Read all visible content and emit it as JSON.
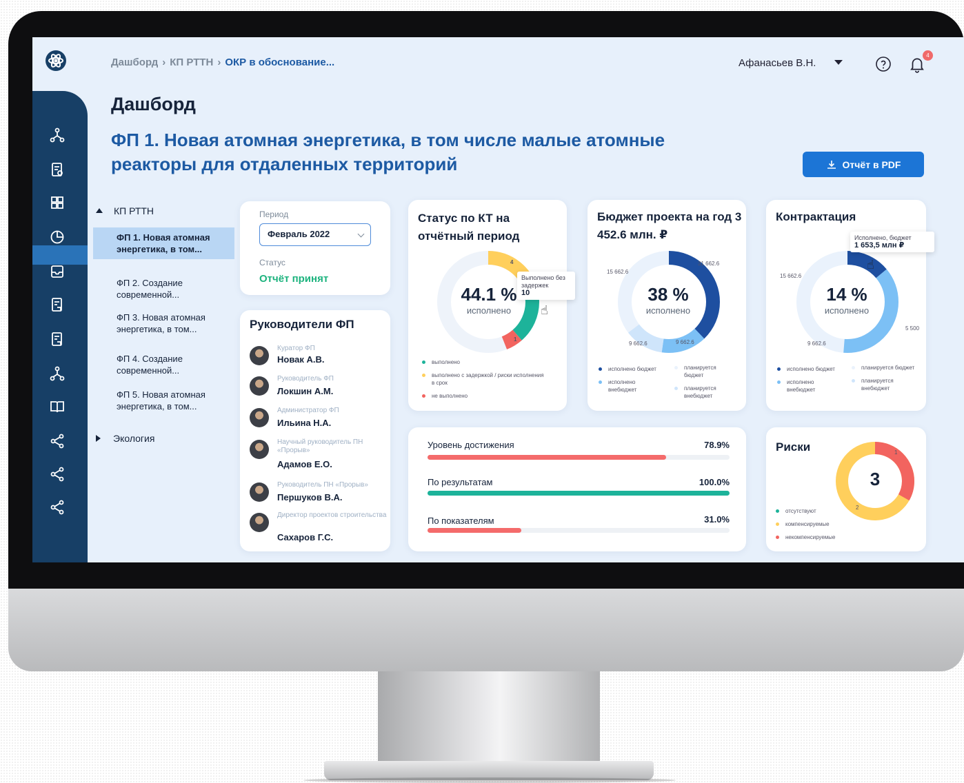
{
  "header": {
    "breadcrumbs": [
      "Дашборд",
      "КП РТТН",
      "ОКР в обоснование..."
    ],
    "separator": "›",
    "user": "Афанасьев В.Н.",
    "notifications": "4"
  },
  "page": {
    "title": "Дашборд",
    "fp_title": "ФП 1. Новая атомная энергетика, в том числе малые атомные реакторы для отдаленных территорий",
    "pdf_button": "Отчёт в PDF"
  },
  "tree": {
    "root": "КП РТТН",
    "items": [
      "ФП 1. Новая атомная энергетика, в том...",
      "ФП 2. Создание современной...",
      "ФП 3. Новая атомная энергетика, в том...",
      "ФП 4. Создание современной...",
      "ФП 5. Новая атомная энергетика, в том..."
    ],
    "collapsed": "Экология"
  },
  "period_card": {
    "period_label": "Период",
    "period_value": "Февраль 2022",
    "status_label": "Статус",
    "status_value": "Отчёт принят"
  },
  "leaders": {
    "title": "Руководители ФП",
    "people": [
      {
        "role": "Куратор ФП",
        "name": "Новак А.В."
      },
      {
        "role": "Руководитель ФП",
        "name": "Локшин А.М."
      },
      {
        "role": "Администратор ФП",
        "name": "Ильина Н.А."
      },
      {
        "role": "Научный руководитель ПН «Прорыв»",
        "name": "Адамов Е.О."
      },
      {
        "role": "Руководитель ПН «Прорыв»",
        "name": "Першуков В.А."
      },
      {
        "role": "Директор проектов строительства",
        "name": "Сахаров Г.С."
      }
    ]
  },
  "kt_status": {
    "title": "Статус по КТ на отчётный период",
    "value": "44.1 %",
    "sub": "исполнено",
    "tooltip_label": "Выполнено без задержек",
    "tooltip_value": "10",
    "seg_label_yellow": "4",
    "seg_label_red": "1",
    "legend": [
      "выполнено",
      "выполнено с задержкой / риски исполнения в срок",
      "не выполнено"
    ],
    "colors": {
      "done": "#1db39a",
      "delayed": "#ffcf5c",
      "failed": "#f2645f",
      "track": "#eef3fa"
    }
  },
  "budget": {
    "title": "Бюджет проекта на год 3 452.6 млн. ₽",
    "value": "38 %",
    "sub": "исполнено",
    "labels": [
      "15 662.6",
      "31 662.6",
      "9 662.6",
      "9 662.6"
    ],
    "legend": [
      "исполнено бюджет",
      "планируется бюджет",
      "исполнено внебюджет",
      "планируется внебюджет"
    ]
  },
  "contracting": {
    "title": "Контрактация",
    "value": "14 %",
    "sub": "исполнено",
    "tooltip_label": "Исполнено, бюджет",
    "tooltip_value": "1 653,5 млн ₽",
    "labels": [
      "15 662.6",
      "5 500",
      "9 662.6"
    ],
    "legend": [
      "исполнено бюджет",
      "планируется бюджет",
      "исполнено внебюджет",
      "планируется внебюджет"
    ]
  },
  "progress": {
    "items": [
      {
        "label": "Уровень достижения",
        "value": "78.9%",
        "fraction": 0.789,
        "color": "#f46b6b"
      },
      {
        "label": "По результатам",
        "value": "100.0%",
        "fraction": 1.0,
        "color": "#1db39a"
      },
      {
        "label": "По показателям",
        "value": "31.0%",
        "fraction": 0.31,
        "color": "#f46b6b"
      }
    ]
  },
  "risks": {
    "title": "Риски",
    "value": "3",
    "seg_label_red": "1",
    "seg_label_yellow": "2",
    "legend": [
      "отсутствуют",
      "компенсируемые",
      "некомпенсируемые"
    ]
  }
}
